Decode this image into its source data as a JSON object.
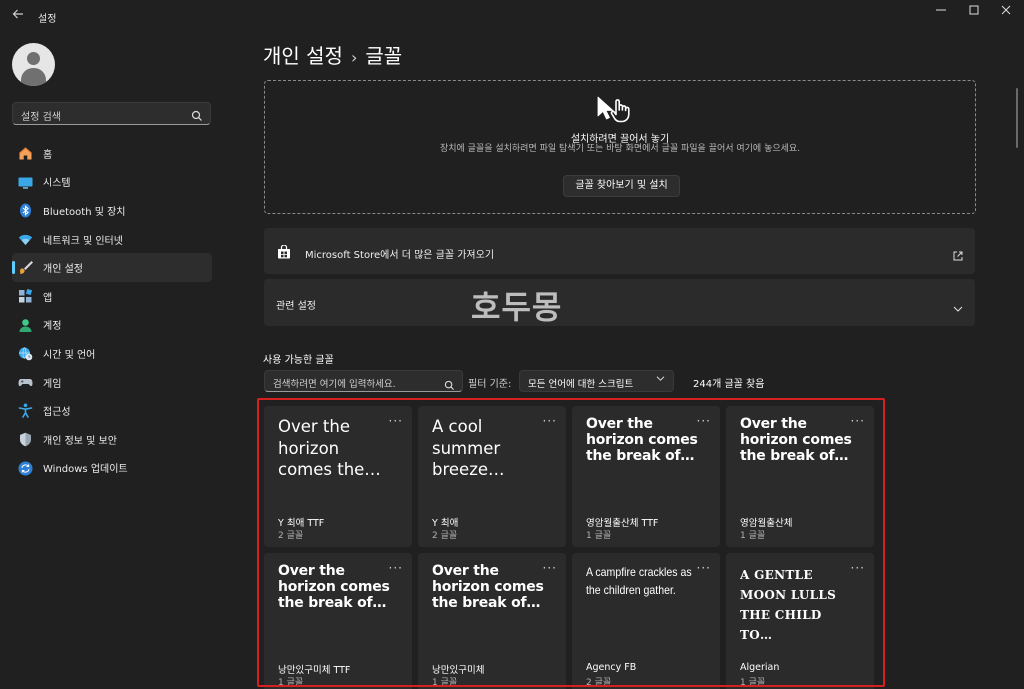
{
  "window": {
    "title": "설정"
  },
  "sidebar": {
    "search_placeholder": "설정 검색",
    "items": [
      {
        "label": "홈",
        "icon": "home-icon"
      },
      {
        "label": "시스템",
        "icon": "monitor-icon"
      },
      {
        "label": "Bluetooth 및 장치",
        "icon": "bluetooth-icon"
      },
      {
        "label": "네트워크 및 인터넷",
        "icon": "wifi-icon"
      },
      {
        "label": "개인 설정",
        "icon": "brush-icon",
        "active": true
      },
      {
        "label": "앱",
        "icon": "apps-icon"
      },
      {
        "label": "계정",
        "icon": "person-icon"
      },
      {
        "label": "시간 및 언어",
        "icon": "globe-clock-icon"
      },
      {
        "label": "게임",
        "icon": "gamepad-icon"
      },
      {
        "label": "접근성",
        "icon": "accessibility-icon"
      },
      {
        "label": "개인 정보 및 보안",
        "icon": "shield-icon"
      },
      {
        "label": "Windows 업데이트",
        "icon": "update-icon"
      }
    ]
  },
  "breadcrumb": {
    "parent": "개인 설정",
    "separator": "›",
    "current": "글꼴"
  },
  "dropzone": {
    "title": "설치하려면 끌어서 놓기",
    "description": "장치에 글꼴을 설치하려면 파일 탐색기 또는 바탕 화면에서 글꼴 파일을 끌어서 여기에 놓으세요.",
    "button": "글꼴 찾아보기 및 설치"
  },
  "store_card": {
    "label": "Microsoft Store에서 더 많은 글꼴 가져오기"
  },
  "related_card": {
    "label": "관련 설정"
  },
  "watermark": "호두몽",
  "fonts": {
    "section_title": "사용 가능한 글꼴",
    "search_placeholder": "검색하려면 여기에 입력하세요.",
    "filter_label": "필터 기준:",
    "filter_value": "모든 언어에 대한 스크립트",
    "found": "244개 글꼴 찾음",
    "tiles": [
      {
        "sample": "Over the horizon comes the…",
        "name": "Y 최애 TTF",
        "count": "2 글꼴",
        "style": "round"
      },
      {
        "sample": "A cool summer breeze…",
        "name": "Y 최애",
        "count": "2 글꼴",
        "style": "round"
      },
      {
        "sample": "Over the horizon comes the break of…",
        "name": "영암월출산체 TTF",
        "count": "1 글꼴",
        "style": "bold"
      },
      {
        "sample": "Over the horizon comes the break of…",
        "name": "영암월출산체",
        "count": "1 글꼴",
        "style": "bold"
      },
      {
        "sample": "Over the horizon comes the break of…",
        "name": "낭만있구미체 TTF",
        "count": "1 글꼴",
        "style": "bold"
      },
      {
        "sample": "Over the horizon comes the break of…",
        "name": "낭만있구미체",
        "count": "1 글꼴",
        "style": "bold"
      },
      {
        "sample": "A campfire crackles as the children gather.",
        "name": "Agency FB",
        "count": "2 글꼴",
        "style": "cond"
      },
      {
        "sample": "A GENTLE MOON LULLS THE CHILD TO…",
        "name": "Algerian",
        "count": "1 글꼴",
        "style": "caps"
      }
    ]
  },
  "colors": {
    "accent": "#60cdff",
    "highlight_box": "#d62020",
    "background": "#202020",
    "card": "#2b2b2b"
  }
}
